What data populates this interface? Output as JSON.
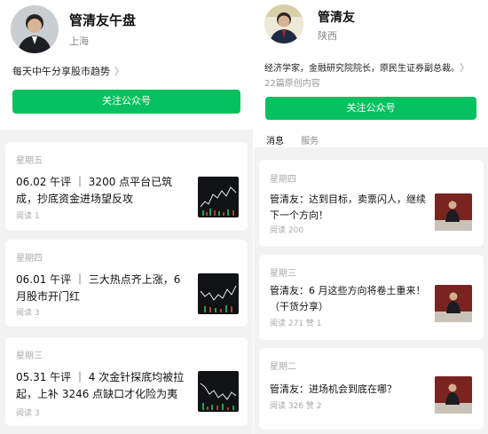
{
  "left": {
    "account": {
      "name": "管清友午盘",
      "location": "上海",
      "description": "每天中午分享股市趋势",
      "follow_label": "关注公众号"
    },
    "articles": [
      {
        "day": "星期五",
        "title": "06.02 午评 ｜ 3200 点平台已筑成，抄底资金进场望反攻",
        "reads": "阅读 1"
      },
      {
        "day": "星期四",
        "title": "06.01 午评 ｜ 三大热点齐上涨，6 月股市开门红",
        "reads": "阅读 3"
      },
      {
        "day": "星期三",
        "title": "05.31 午评 ｜ 4 次金针探底均被拉起，上补 3246 点缺口才化险为夷",
        "reads": "阅读 3"
      }
    ]
  },
  "right": {
    "account": {
      "name": "管清友",
      "location": "陕西",
      "description": "经济学家，金融研究院院长，原民生证券副总裁。",
      "meta": "22篇原创内容",
      "follow_label": "关注公众号"
    },
    "tabs": [
      "消息",
      "服务"
    ],
    "articles": [
      {
        "day": "星期四",
        "title": "管清友：达到目标，卖票闪人，继续下一个方向！",
        "reads": "阅读 200"
      },
      {
        "day": "星期三",
        "title": "管清友：6 月这些方向将卷土重来！（干货分享）",
        "reads": "阅读 271  赞 1"
      },
      {
        "day": "星期二",
        "title": "管清友：进场机会到底在哪？",
        "reads": "阅读 326  赞 2"
      }
    ]
  },
  "colors": {
    "accent": "#07c160",
    "background": "#f2f2f2",
    "muted": "#aaaaaa"
  },
  "icons": {
    "chevron": "chevron-right-icon"
  }
}
